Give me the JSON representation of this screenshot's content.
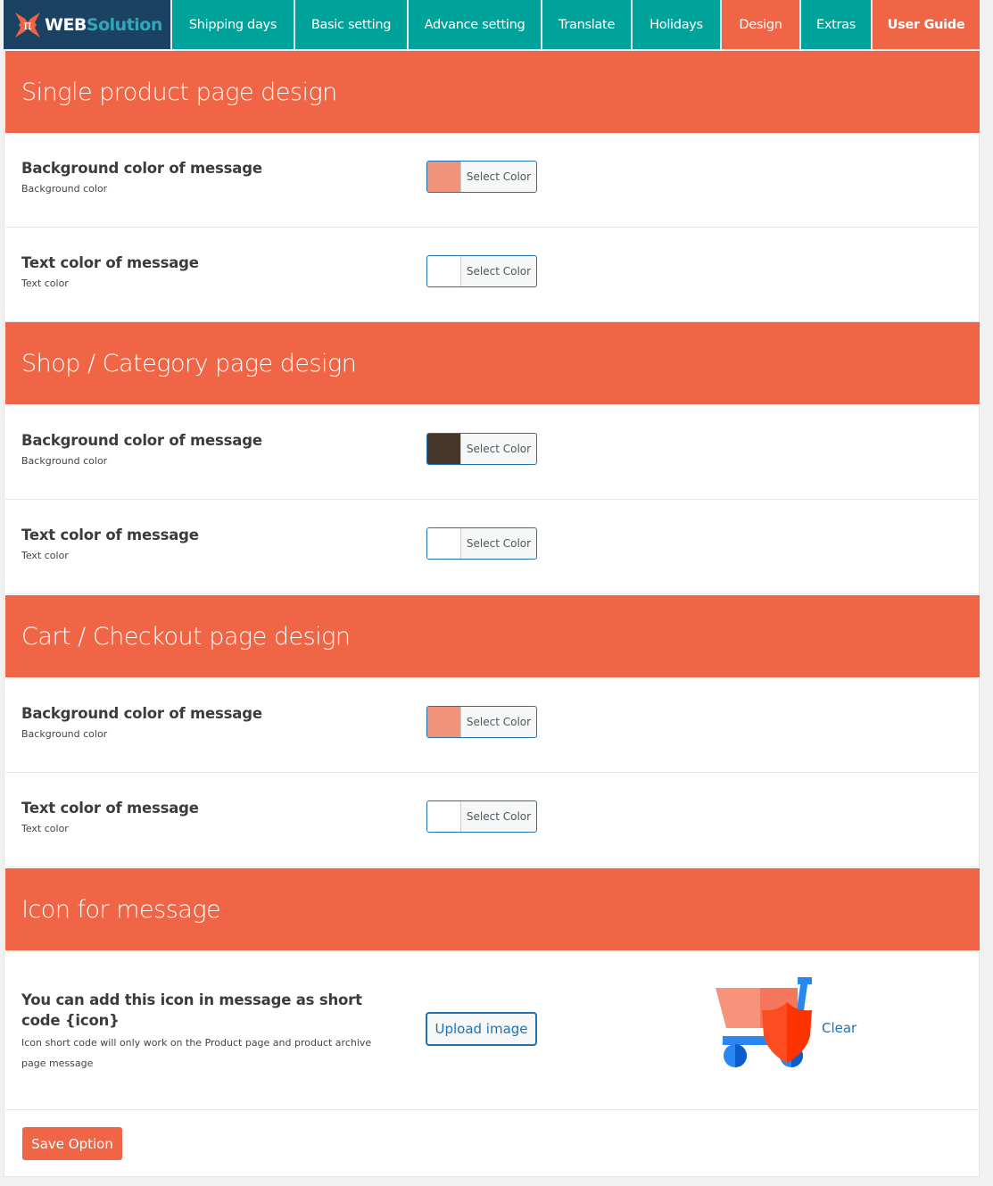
{
  "brand": {
    "logo_glyph": "π",
    "name_primary": "WEB",
    "name_secondary": "Solution"
  },
  "nav": {
    "tabs": [
      {
        "label": "Shipping days"
      },
      {
        "label": "Basic setting"
      },
      {
        "label": "Advance setting"
      },
      {
        "label": "Translate"
      },
      {
        "label": "Holidays"
      },
      {
        "label": "Design",
        "active": true
      },
      {
        "label": "Extras"
      },
      {
        "label": "User Guide"
      }
    ]
  },
  "sections": [
    {
      "title": "Single product page design",
      "rows": [
        {
          "label": "Background color of message",
          "sub": "Background color",
          "color": "#f0937b",
          "button": "Select Color"
        },
        {
          "label": "Text color of message",
          "sub": "Text color",
          "color": "#ffffff",
          "button": "Select Color"
        }
      ]
    },
    {
      "title": "Shop / Category page design",
      "rows": [
        {
          "label": "Background color of message",
          "sub": "Background color",
          "color": "#46372a",
          "button": "Select Color"
        },
        {
          "label": "Text color of message",
          "sub": "Text color",
          "color": "#ffffff",
          "button": "Select Color"
        }
      ]
    },
    {
      "title": "Cart / Checkout page design",
      "rows": [
        {
          "label": "Background color of message",
          "sub": "Background color",
          "color": "#f0937b",
          "button": "Select Color"
        },
        {
          "label": "Text color of message",
          "sub": "Text color",
          "color": "#ffffff",
          "button": "Select Color"
        }
      ]
    },
    {
      "title": "Icon for message"
    }
  ],
  "icon_setting": {
    "label": "You can add this icon in message as short code {icon}",
    "sub": "Icon short code will only work on the Product page and product archive page message",
    "upload_button": "Upload image",
    "preview_icon": "cart-shield-icon",
    "clear_link": "Clear"
  },
  "footer": {
    "save_button": "Save Option"
  },
  "colors": {
    "accent": "#ef6545",
    "tab": "#00a39a",
    "brand_bg": "#1b4163",
    "link": "#2271b1"
  }
}
